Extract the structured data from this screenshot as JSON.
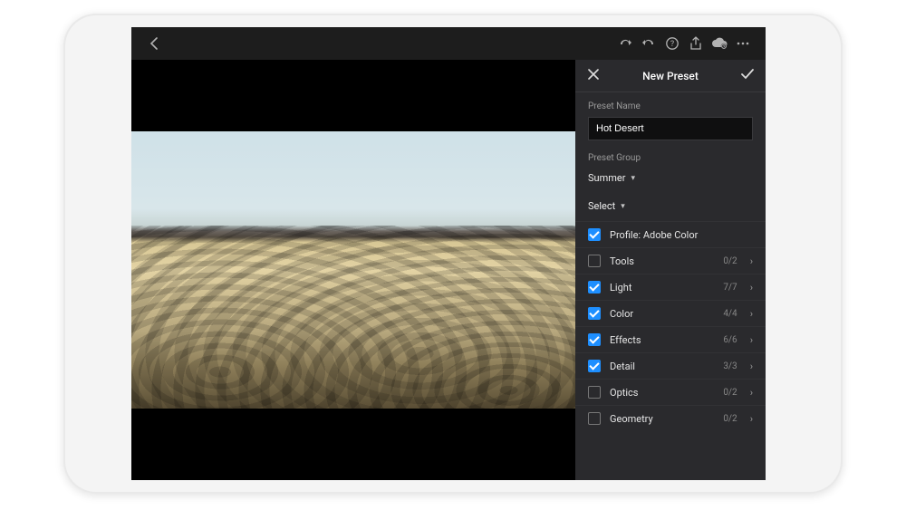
{
  "panel": {
    "title": "New Preset",
    "name_label": "Preset Name",
    "name_value": "Hot Desert",
    "group_label": "Preset Group",
    "group_value": "Summer",
    "select_label": "Select"
  },
  "options": [
    {
      "label": "Profile: Adobe Color",
      "checked": true,
      "count": "",
      "expandable": false
    },
    {
      "label": "Tools",
      "checked": false,
      "count": "0/2",
      "expandable": true
    },
    {
      "label": "Light",
      "checked": true,
      "count": "7/7",
      "expandable": true
    },
    {
      "label": "Color",
      "checked": true,
      "count": "4/4",
      "expandable": true
    },
    {
      "label": "Effects",
      "checked": true,
      "count": "6/6",
      "expandable": true
    },
    {
      "label": "Detail",
      "checked": true,
      "count": "3/3",
      "expandable": true
    },
    {
      "label": "Optics",
      "checked": false,
      "count": "0/2",
      "expandable": true
    },
    {
      "label": "Geometry",
      "checked": false,
      "count": "0/2",
      "expandable": true
    }
  ],
  "colors": {
    "accent": "#1e8fff",
    "panel_bg": "#2a2a2d"
  }
}
